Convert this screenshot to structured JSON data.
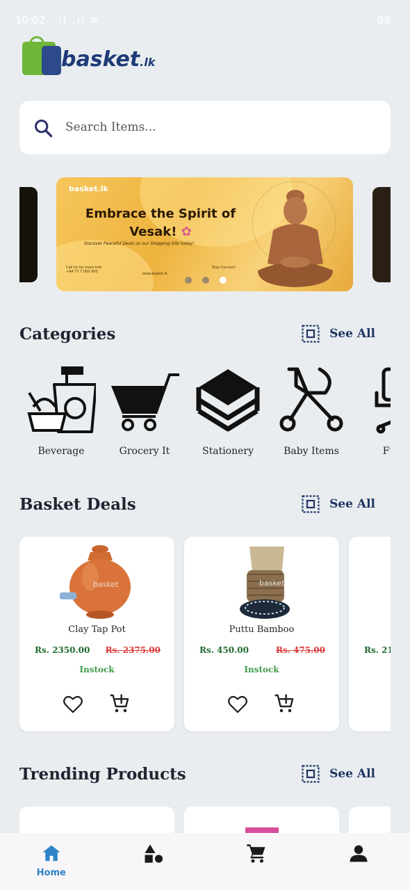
{
  "status_bar": {
    "time": "10:02",
    "battery": "98"
  },
  "brand": {
    "name": "basket",
    "tld": ".lk",
    "colors": {
      "green": "#6fb63a",
      "navy": "#1e3a78"
    }
  },
  "search": {
    "placeholder": "Search Items..."
  },
  "banner": {
    "logo_text": "basket.lk",
    "title_line1": "Embrace the Spirit of",
    "title_line2": "Vesak!",
    "subtitle": "Discover Peaceful Deals on our Shopping Site today!",
    "contact_label": "Call Us for more Info",
    "phone": "+94 77 7 000 000",
    "website": "www.basket.lk",
    "connect_label": "Stay Connect",
    "active_index": 2,
    "slide_count": 3
  },
  "categories_section": {
    "title": "Categories",
    "see_all": "See All",
    "items": [
      {
        "label": "Beverage",
        "icon": "beverage-icon"
      },
      {
        "label": "Grocery It",
        "icon": "shopping-cart-icon"
      },
      {
        "label": "Stationery",
        "icon": "layers-icon"
      },
      {
        "label": "Baby Items",
        "icon": "stroller-icon"
      },
      {
        "label": "Furn",
        "icon": "chair-icon"
      }
    ]
  },
  "deals_section": {
    "title": "Basket Deals",
    "see_all": "See All",
    "products": [
      {
        "name": "Clay Tap Pot",
        "price": "Rs. 2350.00",
        "old_price": "Rs. 2375.00",
        "stock": "Instock"
      },
      {
        "name": "Puttu Bamboo",
        "price": "Rs. 450.00",
        "old_price": "Rs. 475.00",
        "stock": "Instock"
      },
      {
        "name": "",
        "price": "Rs. 21",
        "old_price": "",
        "stock": ""
      }
    ]
  },
  "trending_section": {
    "title": "Trending Products",
    "see_all": "See All"
  },
  "bottom_nav": {
    "active": "Home",
    "items": [
      {
        "label": "Home",
        "icon": "home-icon"
      },
      {
        "label": "",
        "icon": "categories-icon"
      },
      {
        "label": "",
        "icon": "cart-icon"
      },
      {
        "label": "",
        "icon": "profile-icon"
      }
    ],
    "active_color": "#2e83c6"
  }
}
